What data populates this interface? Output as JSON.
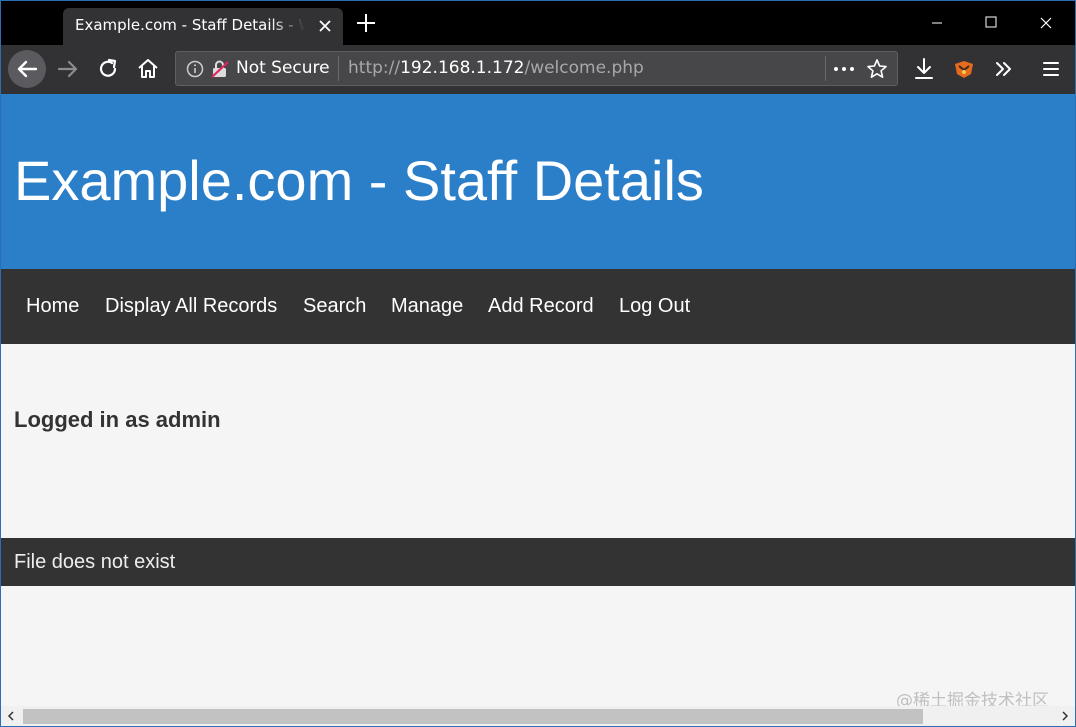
{
  "browser": {
    "tab_title": "Example.com - Staff Details - Welcome",
    "security_label": "Not Secure",
    "url_scheme": "http://",
    "url_host": "192.168.1.172",
    "url_path": "/welcome.php"
  },
  "page": {
    "site_title": "Example.com - Staff Details",
    "nav": [
      {
        "label": "Home"
      },
      {
        "label": "Display All Records"
      },
      {
        "label": "Search"
      },
      {
        "label": "Manage"
      },
      {
        "label": "Add Record"
      },
      {
        "label": "Log Out"
      }
    ],
    "logged_in_text": "Logged in as admin",
    "footer_text": "File does not exist"
  },
  "watermark": "@稀土掘金技术社区",
  "colors": {
    "header_bg": "#2b7fc9",
    "nav_bg": "#333333",
    "page_bg": "#f5f5f5",
    "chrome_bg": "#323234"
  },
  "icons": [
    "close-icon",
    "plus-icon",
    "minimize-icon",
    "maximize-icon",
    "back-icon",
    "forward-icon",
    "reload-icon",
    "home-icon",
    "info-icon",
    "insecure-lock-icon",
    "more-icon",
    "star-icon",
    "download-icon",
    "extension-icon",
    "overflow-icon",
    "menu-icon"
  ]
}
